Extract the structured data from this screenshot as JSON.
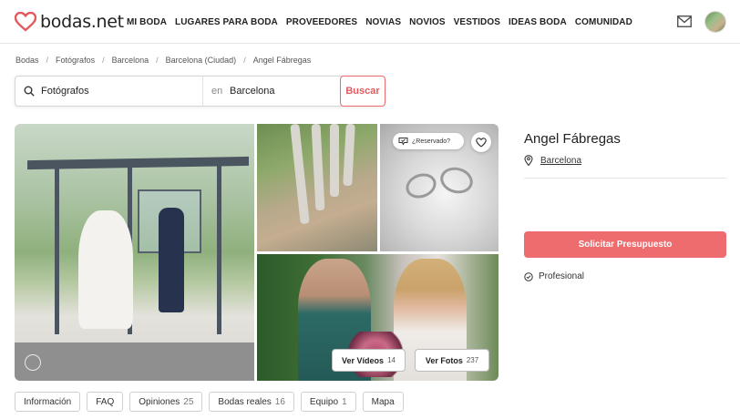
{
  "header": {
    "logo_text": "bodas.net",
    "nav": [
      "MI BODA",
      "LUGARES PARA BODA",
      "PROVEEDORES",
      "NOVIAS",
      "NOVIOS",
      "VESTIDOS",
      "IDEAS BODA",
      "COMUNIDAD"
    ],
    "icons": [
      "heart-logo-icon",
      "mail-icon",
      "avatar"
    ]
  },
  "breadcrumb": [
    "Bodas",
    "Fotógrafos",
    "Barcelona",
    "Barcelona (Ciudad)",
    "Angel Fábregas"
  ],
  "search": {
    "category": "Fotógrafos",
    "en_label": "en",
    "location": "Barcelona",
    "button": "Buscar"
  },
  "gallery": {
    "reserved_label": "¿Reservado?",
    "videos_label": "Ver Vídeos",
    "videos_count": "14",
    "photos_label": "Ver Fotos",
    "photos_count": "237"
  },
  "vendor": {
    "name": "Angel Fábregas",
    "location": "Barcelona",
    "cta": "Solicitar Presupuesto",
    "badge": "Profesional"
  },
  "tabs": [
    {
      "label": "Información",
      "count": ""
    },
    {
      "label": "FAQ",
      "count": ""
    },
    {
      "label": "Opiniones",
      "count": "25"
    },
    {
      "label": "Bodas reales",
      "count": "16"
    },
    {
      "label": "Equipo",
      "count": "1"
    },
    {
      "label": "Mapa",
      "count": ""
    }
  ],
  "colors": {
    "brand": "#e05a5e",
    "cta_bg": "#ee6b6e"
  }
}
